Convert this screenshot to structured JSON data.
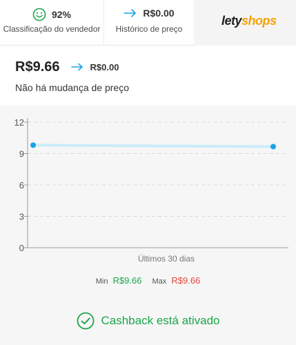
{
  "topbar": {
    "rating": {
      "icon": "smile-icon",
      "value": "92%",
      "label": "Classificação do vendedor"
    },
    "history": {
      "icon": "arrow-right-icon",
      "value": "R$0.00",
      "label": "Histórico de preço"
    },
    "logo": {
      "part1": "lety",
      "part2": "shops"
    }
  },
  "price": {
    "current": "R$9.66",
    "previous": "R$0.00",
    "note": "Não há mudança de preço"
  },
  "chart_data": {
    "type": "line",
    "xlabel": "Últimos 30 dias",
    "ylabel": "",
    "ylim": [
      0,
      12
    ],
    "yticks": [
      "0",
      "3",
      "6",
      "9",
      "12"
    ],
    "series": [
      {
        "values": [
          9.8,
          9.66
        ]
      }
    ],
    "grid": true
  },
  "minmax": {
    "min_label": "Min",
    "min_value": "R$9.66",
    "max_label": "Max",
    "max_value": "R$9.66"
  },
  "cashback": {
    "label": "Cashback está ativado"
  },
  "colors": {
    "accent": "#1aa3e8",
    "green": "#1aa64a",
    "red": "#e0483c",
    "logo_orange": "#f5a20a"
  }
}
